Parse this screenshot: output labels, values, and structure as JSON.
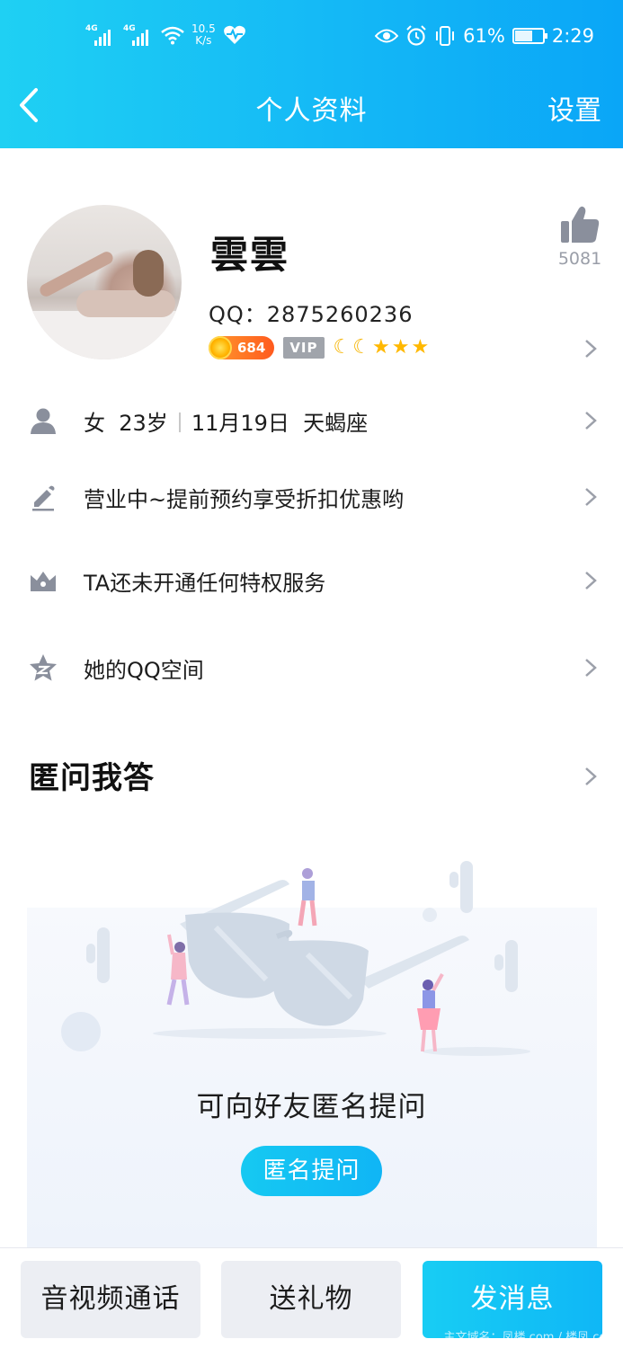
{
  "status_bar": {
    "network_1": "4G",
    "network_2": "4G",
    "speed_value": "10.5",
    "speed_unit": "K/s",
    "battery": "61%",
    "battery_level": 0.61,
    "time": "2:29",
    "icons": [
      "signal-icon",
      "signal-icon",
      "wifi-icon",
      "heart-rate-icon",
      "eye-icon",
      "alarm-icon",
      "vibrate-icon",
      "battery-icon"
    ]
  },
  "nav": {
    "title": "个人资料",
    "settings": "设置"
  },
  "profile": {
    "name": "雲雲",
    "qq": "QQ：2875260236",
    "likes": "5081",
    "coin_level": "684",
    "vip": "VIP",
    "level_icons": [
      "moon",
      "moon",
      "star",
      "star",
      "star"
    ]
  },
  "info_rows": [
    {
      "icon": "person-icon",
      "gender": "女",
      "age": "23岁",
      "birthday": "11月19日",
      "zodiac": "天蝎座"
    },
    {
      "icon": "pencil-icon",
      "text": "营业中~提前预约享受折扣优惠哟"
    },
    {
      "icon": "crown-icon",
      "text": "TA还未开通任何特权服务"
    },
    {
      "icon": "qzone-star-icon",
      "text": "她的QQ空间"
    }
  ],
  "qa": {
    "title": "匿问我答",
    "prompt": "可向好友匿名提问",
    "button": "匿名提问"
  },
  "bottom": {
    "call": "音视频通话",
    "gift": "送礼物",
    "message": "发消息"
  },
  "watermark": "主文域名：凤楼.com / 楼凤.com",
  "colors": {
    "accent": "#14b8f6",
    "icon_gray": "#8a8f9c",
    "coin_orange": "#ff6a1e",
    "star_gold": "#ffb800"
  }
}
